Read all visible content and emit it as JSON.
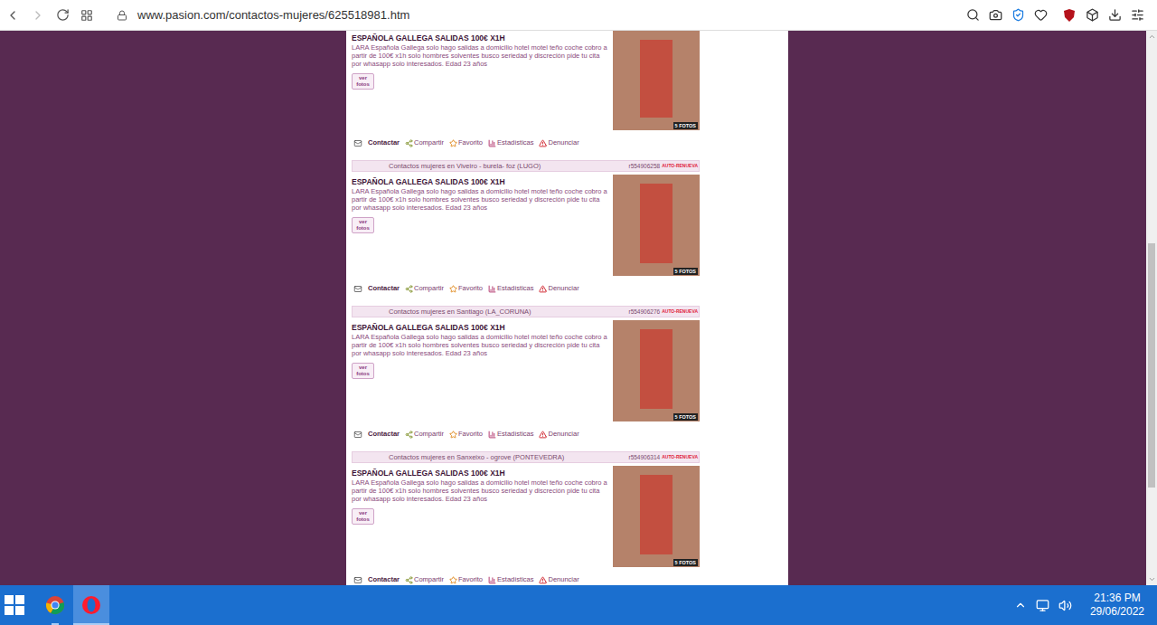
{
  "browser": {
    "url": "www.pasion.com/contactos-mujeres/625518981.htm"
  },
  "actions": [
    {
      "label": "Contactar",
      "kind": "contact"
    },
    {
      "label": "Compartir",
      "kind": "share"
    },
    {
      "label": "Favorito",
      "kind": "favorite"
    },
    {
      "label": "Estadísticas",
      "kind": "stats"
    },
    {
      "label": "Denunciar",
      "kind": "report"
    }
  ],
  "listings": [
    {
      "title": "ESPAÑOLA GALLEGA SALIDAS 100€ X1H",
      "description": "LARA Española Gallega solo hago salidas a domicilio hotel motel teño coche cobro a partir de 100€ x1h solo hombres solventes busco seriedad y discreción pide tu cita por whasapp solo interesados. Edad 23 años",
      "photos_button": "ver fotos",
      "photo_count": "5 FOTOS"
    },
    {
      "location": "Contactos mujeres en Viveiro - burela- foz (LUGO)",
      "ref": "r554906258",
      "badge": "AUTO-RENUEVA",
      "title": "ESPAÑOLA GALLEGA SALIDAS 100€ X1H",
      "description": "LARA Española Gallega solo hago salidas a domicilio hotel motel teño coche cobro a partir de 100€ x1h solo hombres solventes busco seriedad y discreción pide tu cita por whasapp solo interesados. Edad 23 años",
      "photos_button": "ver fotos",
      "photo_count": "5 FOTOS"
    },
    {
      "location": "Contactos mujeres en Santiago (LA_CORUNA)",
      "ref": "r554906276",
      "badge": "AUTO-RENUEVA",
      "title": "ESPAÑOLA GALLEGA SALIDAS 100€ X1H",
      "description": "LARA Española Gallega solo hago salidas a domicilio hotel motel teño coche cobro a partir de 100€ x1h solo hombres solventes busco seriedad y discreción pide tu cita por whasapp solo interesados. Edad 23 años",
      "photos_button": "ver fotos",
      "photo_count": "5 FOTOS"
    },
    {
      "location": "Contactos mujeres en Sanxeixo - ogrove (PONTEVEDRA)",
      "ref": "r554906314",
      "badge": "AUTO-RENUEVA",
      "title": "ESPAÑOLA GALLEGA SALIDAS 100€ X1H",
      "description": "LARA Española Gallega solo hago salidas a domicilio hotel motel teño coche cobro a partir de 100€ x1h solo hombres solventes busco seriedad y discreción pide tu cita por whasapp solo interesados. Edad 23 años",
      "photos_button": "ver fotos",
      "photo_count": "5 FOTOS"
    }
  ],
  "taskbar": {
    "apps": [
      {
        "kind": "chrome",
        "selected": false
      },
      {
        "kind": "opera",
        "selected": true
      }
    ],
    "time": "21:36 PM",
    "date": "29/06/2022"
  }
}
